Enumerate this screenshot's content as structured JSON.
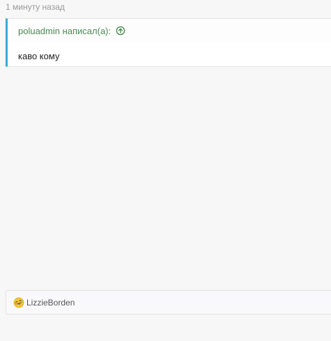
{
  "post": {
    "timestamp": "1 минуту назад"
  },
  "quote": {
    "author_line": "poluadmin написал(а):",
    "goto_icon": "arrow-up-circle-icon",
    "text": "каво кому",
    "accent_color": "#3fa6d8",
    "author_color": "#4c8a52"
  },
  "reactions": {
    "emoji_icon": "rofl-emoji-icon",
    "users": "LizzieBorden"
  }
}
